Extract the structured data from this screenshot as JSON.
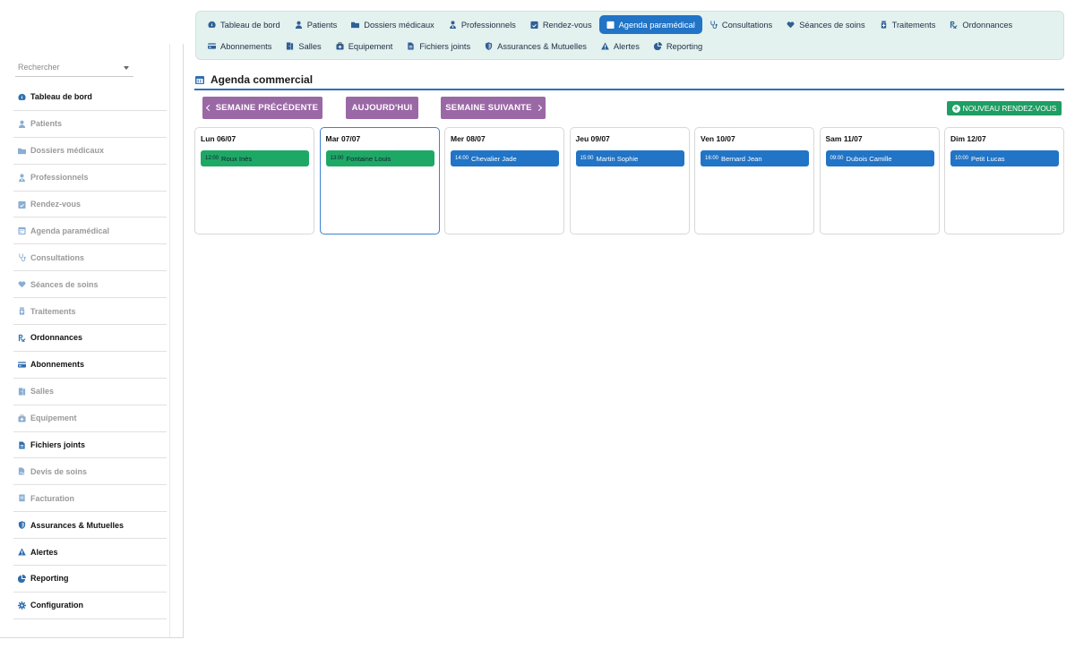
{
  "sidebar": {
    "search_placeholder": "Rechercher",
    "items": [
      {
        "label": "Tableau de bord",
        "icon": "dashboard-icon",
        "active": true
      },
      {
        "label": "Patients",
        "icon": "user-icon",
        "active": false
      },
      {
        "label": "Dossiers médicaux",
        "icon": "folder-icon",
        "active": false
      },
      {
        "label": "Professionnels",
        "icon": "doctor-icon",
        "active": false
      },
      {
        "label": "Rendez-vous",
        "icon": "calendar-check-icon",
        "active": false
      },
      {
        "label": "Agenda paramédical",
        "icon": "calendar-icon",
        "active": false
      },
      {
        "label": "Consultations",
        "icon": "stethoscope-icon",
        "active": false
      },
      {
        "label": "Séances de soins",
        "icon": "heart-icon",
        "active": false
      },
      {
        "label": "Traitements",
        "icon": "pill-bottle-icon",
        "active": false
      },
      {
        "label": "Ordonnances",
        "icon": "prescription-icon",
        "active": true
      },
      {
        "label": "Abonnements",
        "icon": "card-icon",
        "active": true
      },
      {
        "label": "Salles",
        "icon": "door-icon",
        "active": false
      },
      {
        "label": "Equipement",
        "icon": "medkit-icon",
        "active": false
      },
      {
        "label": "Fichiers joints",
        "icon": "file-icon",
        "active": true
      },
      {
        "label": "Devis de soins",
        "icon": "file-signature-icon",
        "active": false
      },
      {
        "label": "Facturation",
        "icon": "invoice-icon",
        "active": false
      },
      {
        "label": "Assurances & Mutuelles",
        "icon": "shield-icon",
        "active": true
      },
      {
        "label": "Alertes",
        "icon": "warning-icon",
        "active": true
      },
      {
        "label": "Reporting",
        "icon": "pie-chart-icon",
        "active": true
      },
      {
        "label": "Configuration",
        "icon": "gear-icon",
        "active": true
      }
    ]
  },
  "topnav": {
    "row1": [
      {
        "label": "Tableau de bord",
        "icon": "dashboard-icon"
      },
      {
        "label": "Patients",
        "icon": "user-icon"
      },
      {
        "label": "Dossiers médicaux",
        "icon": "folder-icon"
      },
      {
        "label": "Professionnels",
        "icon": "doctor-icon"
      },
      {
        "label": "Rendez-vous",
        "icon": "calendar-check-icon"
      },
      {
        "label": "Agenda paramédical",
        "icon": "calendar-icon",
        "active": true
      },
      {
        "label": "Consultations",
        "icon": "stethoscope-icon"
      },
      {
        "label": "Séances de soins",
        "icon": "heart-icon"
      },
      {
        "label": "Traitements",
        "icon": "pill-bottle-icon"
      },
      {
        "label": "Ordonnances",
        "icon": "prescription-icon"
      }
    ],
    "row2": [
      {
        "label": "Abonnements",
        "icon": "card-icon"
      },
      {
        "label": "Salles",
        "icon": "door-icon"
      },
      {
        "label": "Equipement",
        "icon": "medkit-icon"
      },
      {
        "label": "Fichiers joints",
        "icon": "file-icon"
      },
      {
        "label": "Assurances & Mutuelles",
        "icon": "shield-icon"
      },
      {
        "label": "Alertes",
        "icon": "warning-icon"
      },
      {
        "label": "Reporting",
        "icon": "pie-chart-icon"
      }
    ]
  },
  "page": {
    "title": "Agenda commercial",
    "prev_week": "SEMAINE PRÉCÉDENTE",
    "today": "AUJOURD'HUI",
    "next_week": "SEMAINE SUIVANTE",
    "new_appointment": "NOUVEAU RENDEZ-VOUS"
  },
  "colors": {
    "accent": "#2174c6",
    "purple_button": "#9b68a6",
    "green": "#1ea866",
    "nav_bg": "#e3f1ef"
  },
  "days": [
    {
      "label": "Lun 06/07",
      "time": "12:00",
      "name": "Roux Inès",
      "color": "green",
      "selected": false
    },
    {
      "label": "Mar 07/07",
      "time": "13:00",
      "name": "Fontaine Louis",
      "color": "green",
      "selected": true
    },
    {
      "label": "Mer 08/07",
      "time": "14:00",
      "name": "Chevalier Jade",
      "color": "blue",
      "selected": false
    },
    {
      "label": "Jeu 09/07",
      "time": "15:00",
      "name": "Martin Sophie",
      "color": "blue",
      "selected": false
    },
    {
      "label": "Ven 10/07",
      "time": "16:00",
      "name": "Bernard Jean",
      "color": "blue",
      "selected": false
    },
    {
      "label": "Sam 11/07",
      "time": "09:00",
      "name": "Dubois Camille",
      "color": "blue",
      "selected": false
    },
    {
      "label": "Dim 12/07",
      "time": "10:00",
      "name": "Petit Lucas",
      "color": "blue",
      "selected": false
    }
  ]
}
